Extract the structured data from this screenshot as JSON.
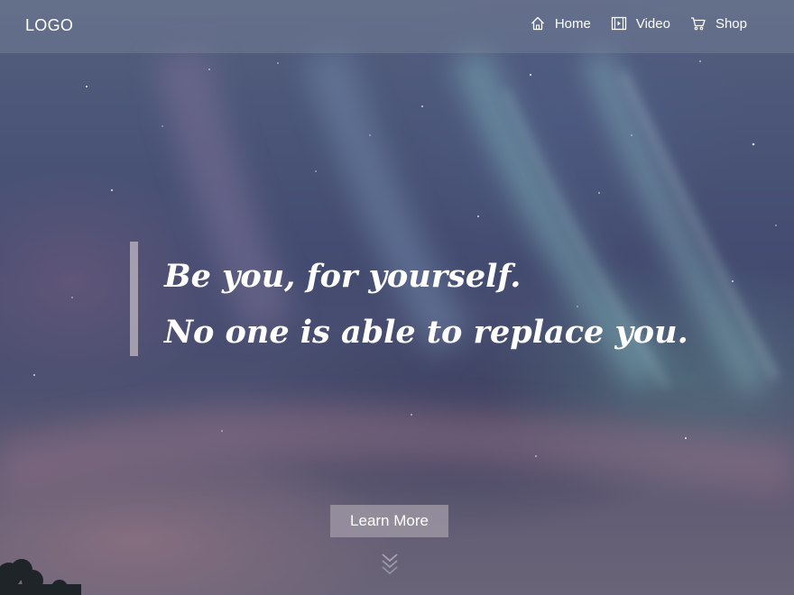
{
  "header": {
    "logo": "LOGO",
    "nav": [
      {
        "label": "Home",
        "icon": "home-icon"
      },
      {
        "label": "Video",
        "icon": "video-icon"
      },
      {
        "label": "Shop",
        "icon": "cart-icon"
      }
    ]
  },
  "hero": {
    "quote_lines": [
      "Be you, for yourself.",
      "No one is able to replace you."
    ],
    "cta_label": "Learn More",
    "scroll_icon": "chevron-double-down-icon"
  }
}
